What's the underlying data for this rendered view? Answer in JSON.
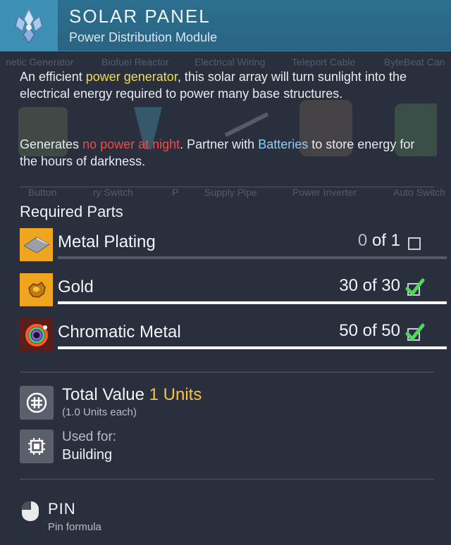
{
  "header": {
    "title": "SOLAR PANEL",
    "subtitle": "Power Distribution Module",
    "icon": "solar-panel-crystal-icon"
  },
  "background": {
    "top_labels": [
      "netic Generator",
      "Biofuel Reactor",
      "Electrical Wiring",
      "Teleport Cable",
      "ByteBeat Can"
    ],
    "bottom_labels": [
      "Button",
      "ry Switch",
      "P",
      "Supply Pipe",
      "Power Inverter",
      "Auto Switch"
    ]
  },
  "description": {
    "p1_before": "An efficient ",
    "p1_highlight": "power generator",
    "p1_after": ", this solar array will turn sunlight into the electrical energy required to power many base structures.",
    "p2_before": "Generates ",
    "p2_red": "no power at night",
    "p2_middle": ". Partner with ",
    "p2_blue": "Batteries",
    "p2_after": " to store energy for the hours of darkness."
  },
  "required_parts": {
    "title": "Required Parts",
    "items": [
      {
        "name": "Metal Plating",
        "have": "0",
        "sep": " of ",
        "need": "1",
        "complete": false,
        "progress": 0.0,
        "icon": "metal-plating-icon"
      },
      {
        "name": "Gold",
        "have": "30",
        "sep": " of ",
        "need": "30",
        "complete": true,
        "progress": 1.0,
        "icon": "gold-icon"
      },
      {
        "name": "Chromatic Metal",
        "have": "50",
        "sep": " of ",
        "need": "50",
        "complete": true,
        "progress": 1.0,
        "icon": "chromatic-metal-icon"
      }
    ]
  },
  "total": {
    "label": "Total Value ",
    "value": "1 Units",
    "each": "(1.0 Units each)",
    "icon": "units-currency-icon"
  },
  "used_for": {
    "label": "Used for:",
    "value": "Building",
    "icon": "chip-icon"
  },
  "pin": {
    "label": "PIN",
    "sub": "Pin formula",
    "icon": "mouse-icon"
  },
  "colors": {
    "header_bg": "#2a6483",
    "panel_bg": "#2a2f3d",
    "highlight_yellow": "#f0dc4a",
    "highlight_red": "#ef4b45",
    "highlight_blue": "#8fd0f4",
    "units_gold": "#f5c442",
    "check_green": "#4fd85a"
  }
}
